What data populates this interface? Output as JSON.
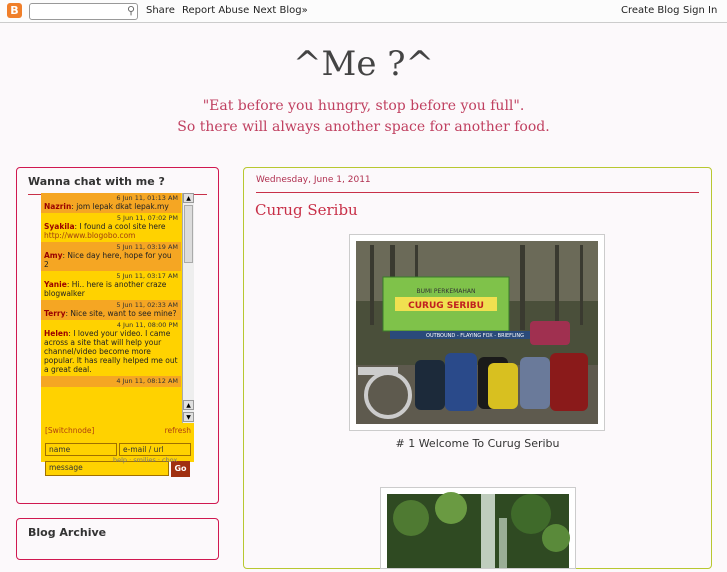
{
  "navbar": {
    "logo": "B",
    "search_value": "",
    "share": "Share",
    "report": "Report Abuse",
    "next": "Next Blog»",
    "create": "Create Blog",
    "signin": "Sign In"
  },
  "header": {
    "title": "^Me ?^",
    "desc_line1": "\"Eat before you hungry, stop before you full\".",
    "desc_line2": "So there will always another space for another food."
  },
  "sidebar": {
    "chat_title": "Wanna chat with me ?",
    "archive_title": "Blog Archive",
    "chat": {
      "messages": [
        {
          "time": "6 Jun 11, 01:13 AM",
          "nick": "Nazrin",
          "text": ": jom lepak dkat lepak.my",
          "link": ""
        },
        {
          "time": "5 Jun 11, 07:02 PM",
          "nick": "Syakila",
          "text": ": I found a cool site here",
          "link": "http://www.blogobo.com"
        },
        {
          "time": "5 Jun 11, 03:19 AM",
          "nick": "Amy",
          "text": ": Nice day here, hope for you 2",
          "link": ""
        },
        {
          "time": "5 Jun 11, 03:17 AM",
          "nick": "Yanie",
          "text": ": Hi.. here is another craze blogwalker",
          "link": ""
        },
        {
          "time": "5 Jun 11, 02:33 AM",
          "nick": "Terry",
          "text": ": Nice site, want to see mine?",
          "link": ""
        },
        {
          "time": "4 Jun 11, 08:00 PM",
          "nick": "Helen",
          "text": ": I loved your video. I came across a site that will help your channel/video become more popular. It has really helped me out a great deal.",
          "link": ""
        },
        {
          "time": "4 Jun 11, 08:12 AM",
          "nick": "",
          "text": "",
          "link": ""
        }
      ],
      "switchnode": "[Switchnode]",
      "refresh": "refresh",
      "name_placeholder": "name",
      "email_placeholder": "e-mail / url",
      "message_placeholder": "message",
      "go": "Go",
      "footer": "help · smilies · cbox"
    }
  },
  "post": {
    "date": "Wednesday, June 1, 2011",
    "title": "Curug Seribu",
    "caption": "# 1 Welcome To Curug Seribu",
    "banner_top": "BUMI PERKEMAHAN",
    "banner_main": "CURUG SERIBU",
    "banner_bottom": "OUTBOUND - FLAYING FOX - BRIEFLING"
  },
  "colors": {
    "accent": "#c83048",
    "chat_bg": "#ffd200",
    "chat_alt": "#f5a623",
    "main_border": "#b8c830"
  }
}
